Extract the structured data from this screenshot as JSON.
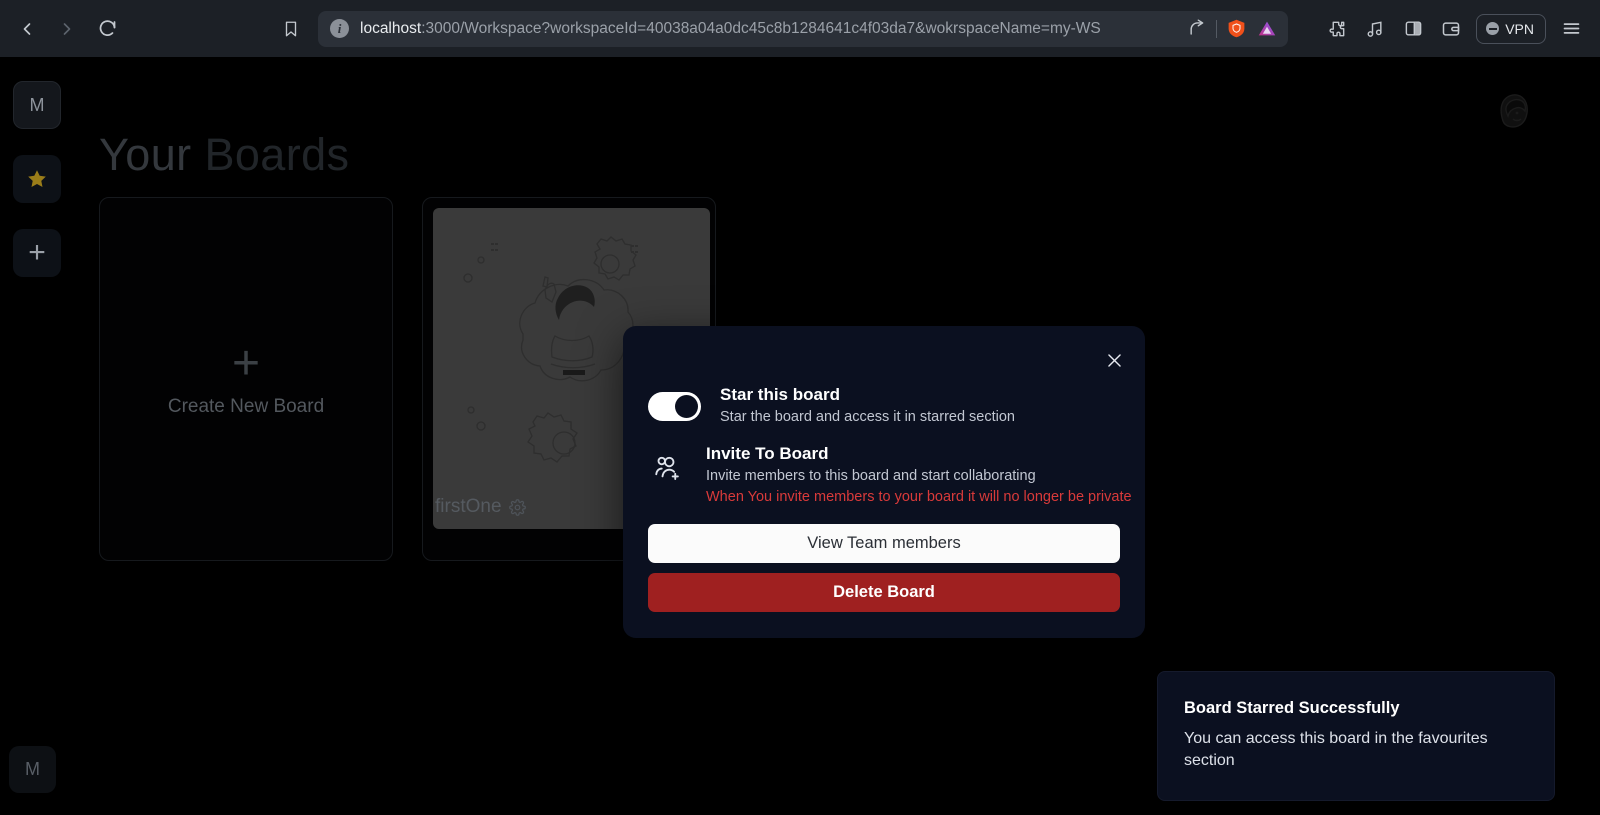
{
  "browser": {
    "back_label": "Back",
    "forward_label": "Forward",
    "reload_label": "Reload",
    "bookmark_label": "Bookmark",
    "url_host": "localhost",
    "url_path": ":3000/Workspace?workspaceId=40038a04a0dc45c8b1284641c4f03da7&wokrspaceName=my-WS",
    "share_label": "Share",
    "brave_label": "Brave Shields",
    "extension_label": "Extension",
    "extensions_label": "Extensions",
    "music_label": "Music",
    "sidebar_label": "Sidebar",
    "wallet_label": "Wallet",
    "vpn_label": "VPN",
    "menu_label": "Menu"
  },
  "sidebar": {
    "workspace_initial": "M",
    "star_label": "Starred",
    "add_label": "+",
    "avatar_initial": "M"
  },
  "page": {
    "title_strong": "Your",
    "title_muted": "Boards"
  },
  "boards": {
    "create": {
      "plus": "+",
      "label": "Create New Board"
    },
    "items": [
      {
        "name": "firstOne",
        "settings_label": "Board settings",
        "open_label": "Open"
      }
    ]
  },
  "modal": {
    "close_label": "×",
    "star": {
      "title": "Star this board",
      "subtitle": "Star the board and access it in starred section",
      "toggle_state": "on"
    },
    "invite": {
      "title": "Invite To Board",
      "subtitle": "Invite members to this board and start collaborating",
      "warning": "When You invite members to your board it will no longer be private"
    },
    "view_members_label": "View Team members",
    "delete_label": "Delete Board"
  },
  "toast": {
    "title": "Board Starred Successfully",
    "message": "You can access this board in the favourites section"
  },
  "colors": {
    "modal_bg": "#0b1020",
    "delete_red": "#9f2020",
    "warning_red": "#d93a3a",
    "star_gold": "#9a7d19",
    "chrome_bg": "#1c2026"
  }
}
